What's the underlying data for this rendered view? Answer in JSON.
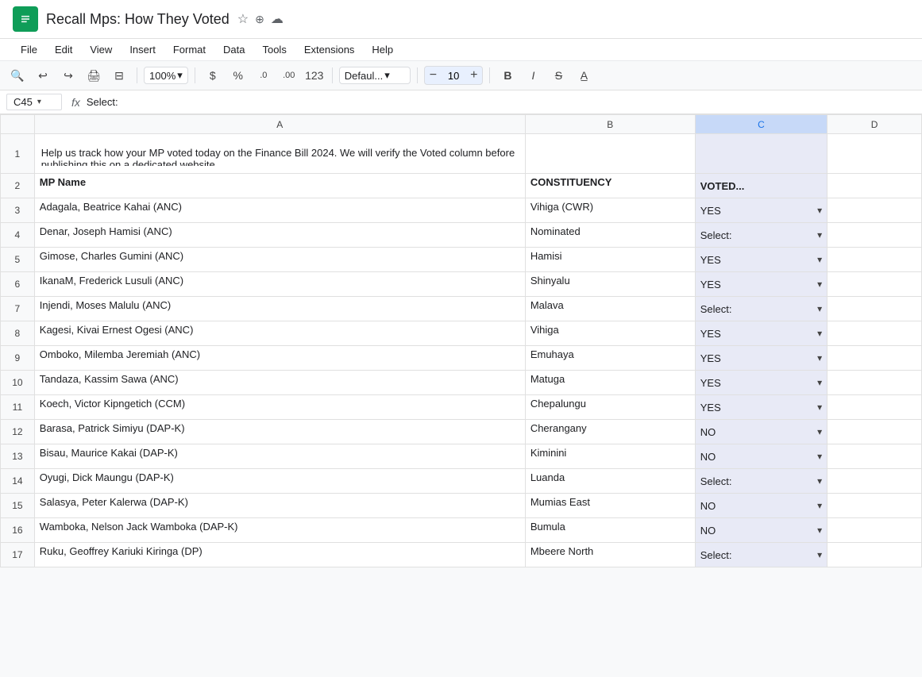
{
  "app": {
    "icon": "■",
    "title": "Recall Mps: How They Voted",
    "star_icon": "☆",
    "cloud_icons": [
      "⊕",
      "☁"
    ]
  },
  "menu": {
    "items": [
      "File",
      "Edit",
      "View",
      "Insert",
      "Format",
      "Data",
      "Tools",
      "Extensions",
      "Help"
    ]
  },
  "toolbar": {
    "zoom": "100%",
    "currency": "$",
    "percent": "%",
    "decimal_less": ".0",
    "decimal_more": ".00",
    "number_format": "123",
    "font": "Defaul...",
    "font_size": "10",
    "bold": "B",
    "italic": "I",
    "strikethrough": "S̶"
  },
  "formula_bar": {
    "cell_ref": "C45",
    "formula": "Select:"
  },
  "columns": {
    "headers": [
      "",
      "A",
      "B",
      "C",
      "D"
    ],
    "col_a_label": "A",
    "col_b_label": "B",
    "col_c_label": "C",
    "col_d_label": "D"
  },
  "rows": [
    {
      "num": "1",
      "a": "Help us track how your MP voted today on the Finance Bill 2024. We will verify the Voted column before publishing this on a dedicated website.",
      "b": "",
      "c": "",
      "d": ""
    },
    {
      "num": "2",
      "a": "MP Name",
      "b": "CONSTITUENCY",
      "c": "VOTED...",
      "d": ""
    },
    {
      "num": "3",
      "a": "Adagala, Beatrice Kahai (ANC)",
      "b": "Vihiga (CWR)",
      "c": "YES",
      "d": ""
    },
    {
      "num": "4",
      "a": "Denar, Joseph Hamisi (ANC)",
      "b": "Nominated",
      "c": "Select:",
      "d": ""
    },
    {
      "num": "5",
      "a": "Gimose, Charles Gumini (ANC)",
      "b": "Hamisi",
      "c": "YES",
      "d": ""
    },
    {
      "num": "6",
      "a": "IkanaM, Frederick Lusuli (ANC)",
      "b": "Shinyalu",
      "c": "YES",
      "d": ""
    },
    {
      "num": "7",
      "a": "Injendi, Moses Malulu (ANC)",
      "b": "Malava",
      "c": "Select:",
      "d": ""
    },
    {
      "num": "8",
      "a": "Kagesi, Kivai Ernest Ogesi (ANC)",
      "b": "Vihiga",
      "c": "YES",
      "d": ""
    },
    {
      "num": "9",
      "a": "Omboko, Milemba Jeremiah (ANC)",
      "b": "Emuhaya",
      "c": "YES",
      "d": ""
    },
    {
      "num": "10",
      "a": "Tandaza, Kassim Sawa (ANC)",
      "b": "Matuga",
      "c": "YES",
      "d": ""
    },
    {
      "num": "11",
      "a": "Koech, Victor Kipngetich (CCM)",
      "b": "Chepalungu",
      "c": "YES",
      "d": ""
    },
    {
      "num": "12",
      "a": "Barasa, Patrick Simiyu (DAP-K)",
      "b": "Cherangany",
      "c": "NO",
      "d": ""
    },
    {
      "num": "13",
      "a": "Bisau, Maurice Kakai (DAP-K)",
      "b": "Kiminini",
      "c": "NO",
      "d": ""
    },
    {
      "num": "14",
      "a": "Oyugi, Dick Maungu (DAP-K)",
      "b": "Luanda",
      "c": "Select:",
      "d": ""
    },
    {
      "num": "15",
      "a": "Salasya, Peter Kalerwa (DAP-K)",
      "b": "Mumias East",
      "c": "NO",
      "d": ""
    },
    {
      "num": "16",
      "a": "Wamboka, Nelson Jack Wamboka (DAP-K)",
      "b": "Bumula",
      "c": "NO",
      "d": ""
    },
    {
      "num": "17",
      "a": "Ruku, Geoffrey Kariuki Kiringa (DP)",
      "b": "Mbeere North",
      "c": "Select:",
      "d": ""
    }
  ]
}
